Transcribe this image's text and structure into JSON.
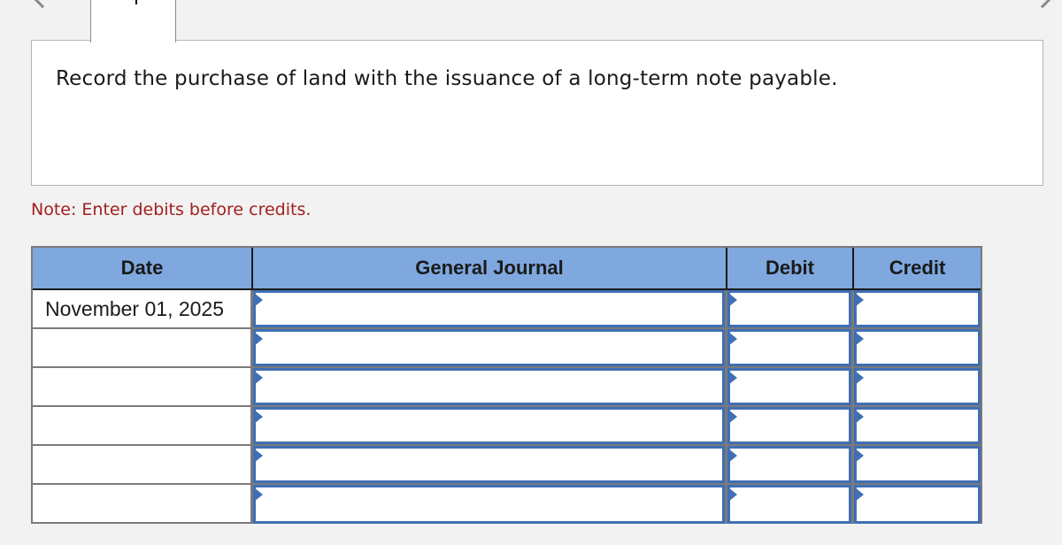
{
  "navigation": {
    "prev_icon": "chevron-left-icon",
    "next_icon": "chevron-right-icon"
  },
  "prompt": {
    "text": "Record the purchase of land with the issuance of a long-term note payable."
  },
  "note": "Note: Enter debits before credits.",
  "journal": {
    "headers": {
      "date": "Date",
      "account": "General Journal",
      "debit": "Debit",
      "credit": "Credit"
    },
    "rows": [
      {
        "date": "November 01, 2025",
        "account": "",
        "debit": "",
        "credit": ""
      },
      {
        "date": "",
        "account": "",
        "debit": "",
        "credit": ""
      },
      {
        "date": "",
        "account": "",
        "debit": "",
        "credit": ""
      },
      {
        "date": "",
        "account": "",
        "debit": "",
        "credit": ""
      },
      {
        "date": "",
        "account": "",
        "debit": "",
        "credit": ""
      },
      {
        "date": "",
        "account": "",
        "debit": "",
        "credit": ""
      }
    ]
  },
  "colors": {
    "header_bg": "#7ea8de",
    "input_border": "#3f6fb5",
    "note_color": "#a31f1f",
    "page_bg": "#f2f2f2"
  }
}
